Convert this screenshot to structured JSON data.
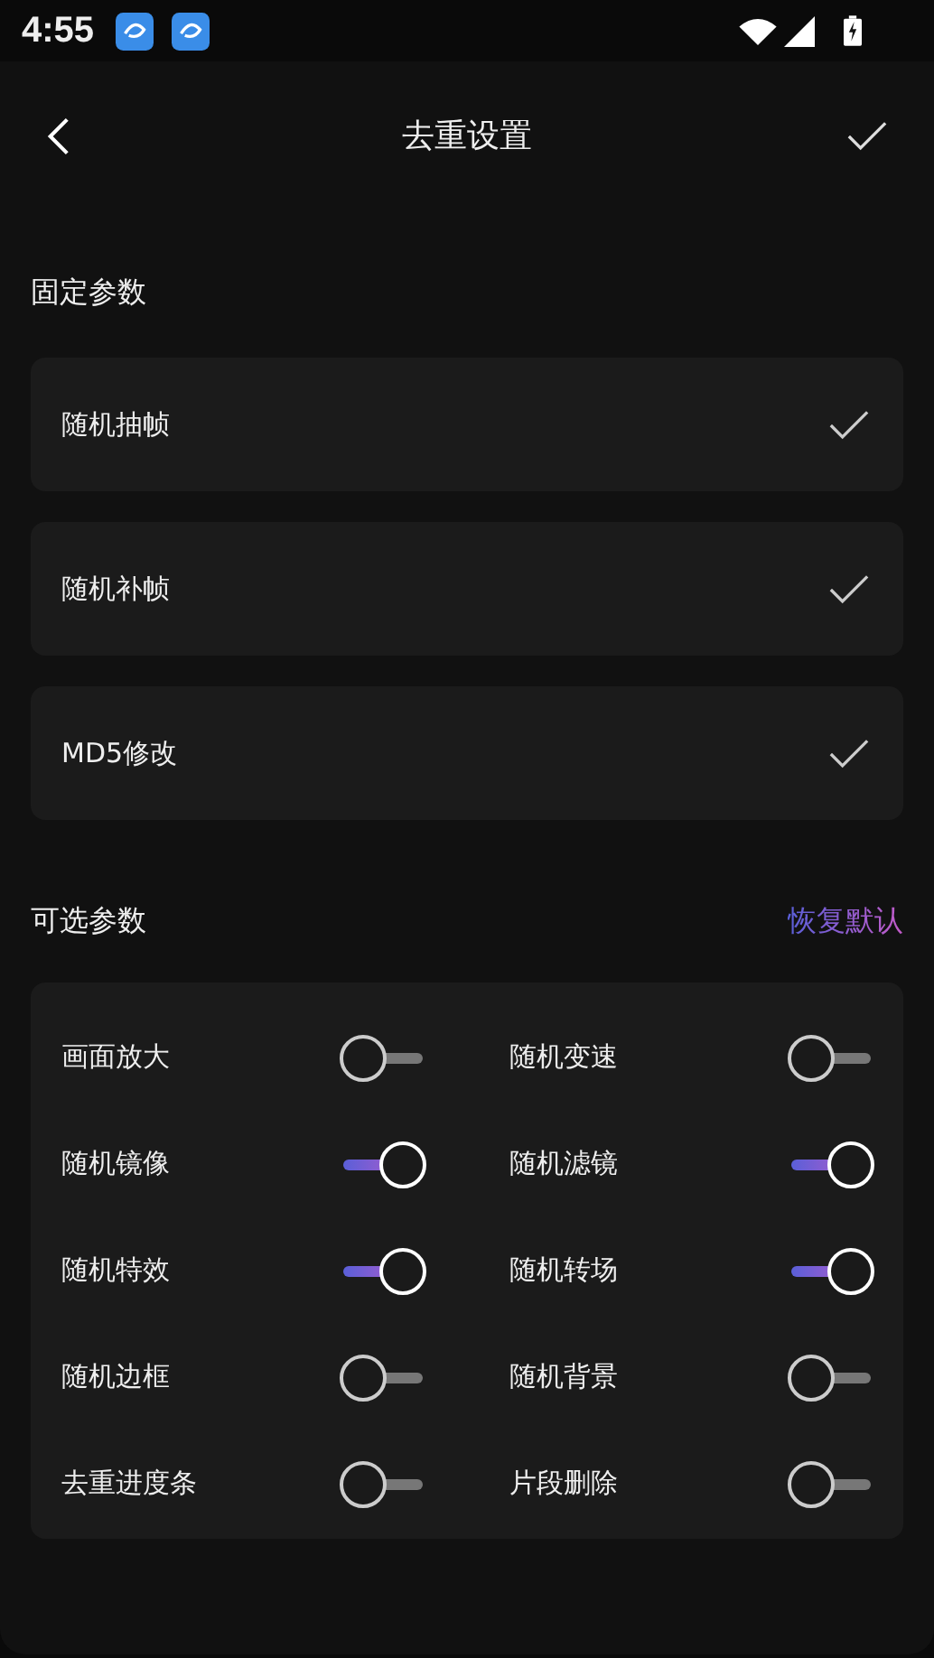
{
  "status_bar": {
    "time": "4:55"
  },
  "header": {
    "title": "去重设置"
  },
  "fixed_section": {
    "title": "固定参数",
    "items": [
      {
        "label": "随机抽帧",
        "checked": true
      },
      {
        "label": "随机补帧",
        "checked": true
      },
      {
        "label": "MD5修改",
        "checked": true
      }
    ]
  },
  "optional_section": {
    "title": "可选参数",
    "reset_link": "恢复默认",
    "toggles": [
      {
        "label": "画面放大",
        "on": false
      },
      {
        "label": "随机变速",
        "on": false
      },
      {
        "label": "随机镜像",
        "on": true
      },
      {
        "label": "随机滤镜",
        "on": true
      },
      {
        "label": "随机特效",
        "on": true
      },
      {
        "label": "随机转场",
        "on": true
      },
      {
        "label": "随机边框",
        "on": false
      },
      {
        "label": "随机背景",
        "on": false
      },
      {
        "label": "去重进度条",
        "on": false
      },
      {
        "label": "片段删除",
        "on": false
      }
    ]
  }
}
